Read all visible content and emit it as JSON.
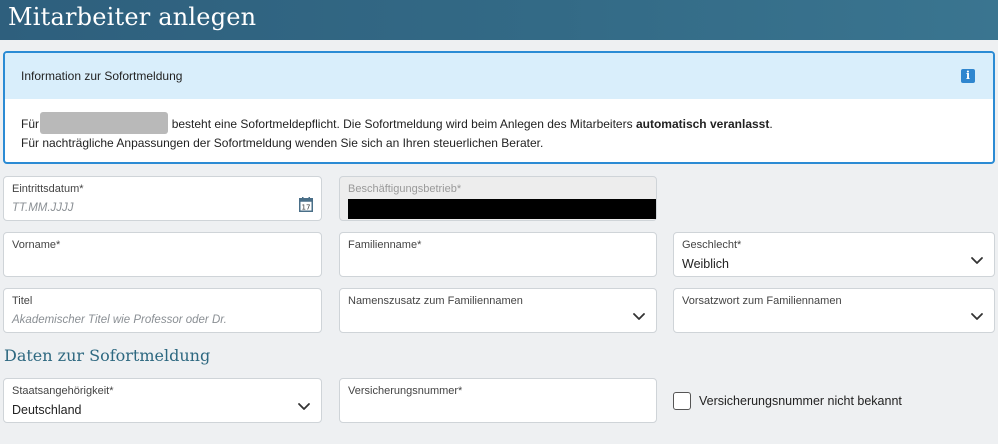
{
  "page": {
    "title": "Mitarbeiter anlegen"
  },
  "info": {
    "title": "Information zur Sofortmeldung",
    "icon": "info-icon",
    "line1_prefix": "Für",
    "line1_middle": "besteht eine Sofortmeldepflicht. Die Sofortmeldung wird beim Anlegen des Mitarbeiters",
    "line1_bold": "automatisch veranlasst",
    "line1_suffix": ".",
    "line2": "Für nachträgliche Anpassungen der Sofortmeldung wenden Sie sich an Ihren steuerlichen Berater."
  },
  "fields": {
    "eintrittsdatum": {
      "label": "Eintrittsdatum*",
      "placeholder": "TT.MM.JJJJ",
      "icon": "calendar-icon",
      "icon_text": "17"
    },
    "betrieb": {
      "label": "Beschäftigungsbetrieb*"
    },
    "vorname": {
      "label": "Vorname*",
      "value": ""
    },
    "familienname": {
      "label": "Familienname*",
      "value": ""
    },
    "geschlecht": {
      "label": "Geschlecht*",
      "value": "Weiblich"
    },
    "titel": {
      "label": "Titel",
      "placeholder": "Akademischer Titel wie Professor oder Dr."
    },
    "namenszusatz": {
      "label": "Namenszusatz zum Familiennamen",
      "value": ""
    },
    "vorsatzwort": {
      "label": "Vorsatzwort zum Familiennamen",
      "value": ""
    },
    "staatsangehoerigkeit": {
      "label": "Staatsangehörigkeit*",
      "value": "Deutschland"
    },
    "versicherungsnummer": {
      "label": "Versicherungsnummer*",
      "value": ""
    }
  },
  "section": {
    "title": "Daten zur Sofortmeldung"
  },
  "checkbox": {
    "label": "Versicherungsnummer nicht bekannt",
    "checked": false
  },
  "colors": {
    "header": "#336a86",
    "info_border": "#2b8bd4",
    "info_head_bg": "#d9eefb",
    "section_title": "#2d6880"
  }
}
